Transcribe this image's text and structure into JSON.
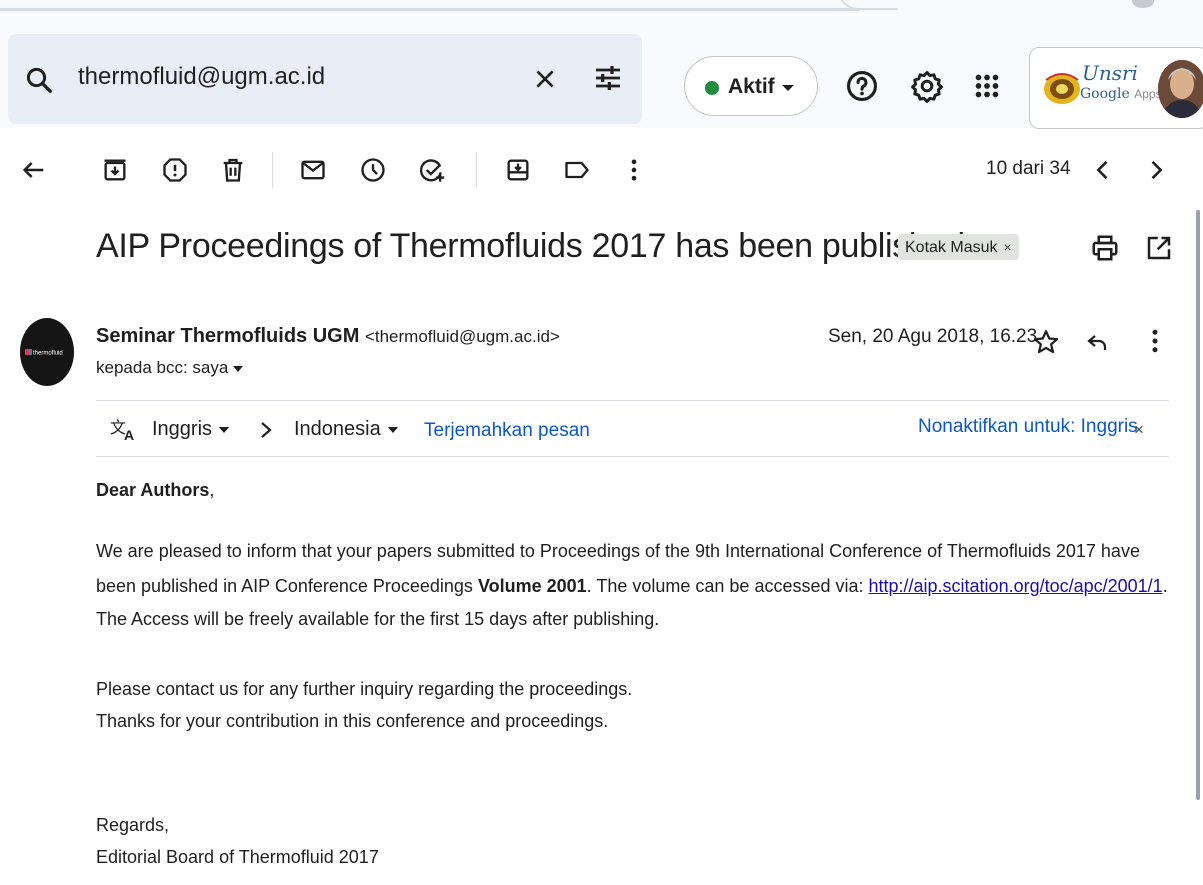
{
  "search": {
    "query": "thermofluid@ugm.ac.id",
    "search_icon": "search-icon",
    "clear_icon": "close-icon",
    "options_icon": "tune-icon"
  },
  "header": {
    "status_label": "Aktif",
    "status_color": "#1e8e3e",
    "help_icon": "help-icon",
    "settings_icon": "gear-icon",
    "apps_icon": "apps-grid-icon",
    "account": {
      "brand_name": "Unsri",
      "brand_google": "Google",
      "brand_apps": "Apps"
    }
  },
  "toolbar": {
    "back_icon": "arrow-left-icon",
    "archive_icon": "archive-icon",
    "spam_icon": "report-spam-icon",
    "delete_icon": "trash-icon",
    "unread_icon": "mail-icon",
    "snooze_icon": "clock-icon",
    "task_icon": "add-task-icon",
    "move_icon": "move-to-icon",
    "label_icon": "label-icon",
    "more_icon": "more-vertical-icon",
    "count": "10 dari 34",
    "prev_icon": "chevron-left-icon",
    "next_icon": "chevron-right-icon"
  },
  "message": {
    "subject": "AIP Proceedings of Thermofluids 2017 has been published",
    "label_chip": "Kotak Masuk",
    "label_remove": "×",
    "sender_name": "Seminar Thermofluids UGM",
    "sender_email": "<thermofluid@ugm.ac.id>",
    "recipient": "kepada bcc: saya",
    "date": "Sen, 20 Agu 2018, 16.23",
    "avatar_text": "thermofluid"
  },
  "translate": {
    "source_lang": "Inggris",
    "target_lang": "Indonesia",
    "translate_link": "Terjemahkan pesan",
    "disable_link": "Nonaktifkan untuk: Inggris",
    "disable_close": "×"
  },
  "body": {
    "greeting_bold": "Dear Authors",
    "greeting_tail": ",",
    "p1_line1": "We are pleased to inform that your papers submitted to Proceedings of the 9th International Conference of Thermofluids 2017 have",
    "p1_line2_a": "been published in AIP Conference Proceedings ",
    "p1_line2_bold": "Volume 2001",
    "p1_line2_b": ". The volume can be accessed via: ",
    "p1_link": "http://aip.scitation.org/toc/apc/2001/1",
    "p1_line2_c": ".",
    "p1_line3": "The Access will be freely available for the first 15 days after publishing.",
    "p2_line1": "Please contact us for any further inquiry regarding the proceedings.",
    "p2_line2": "Thanks for your contribution in this conference and proceedings.",
    "closing": "Regards,",
    "signature": "Editorial Board of Thermofluid 2017"
  }
}
